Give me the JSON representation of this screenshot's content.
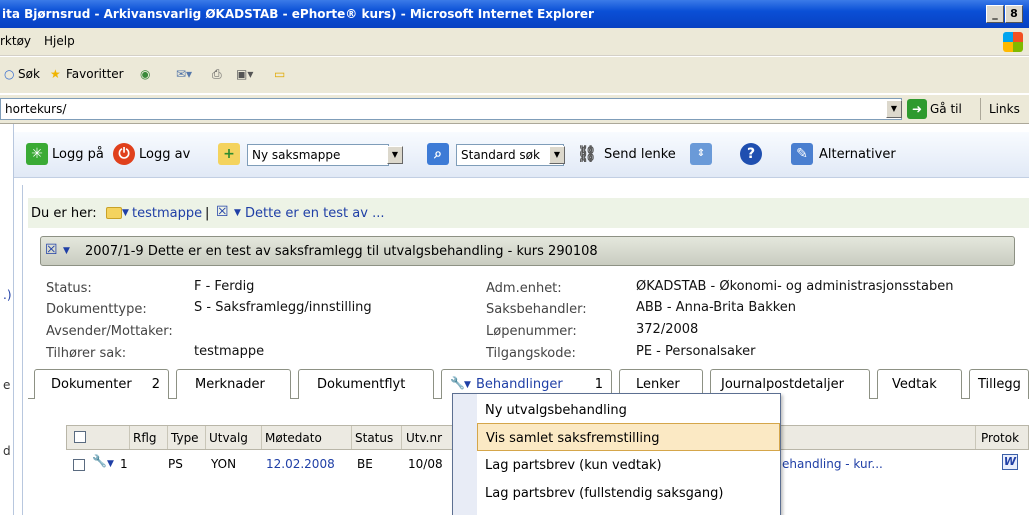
{
  "window": {
    "title": "ita Bjørnsrud - Arkivansvarlig ØKADSTAB - ePhorte® kurs) - Microsoft Internet Explorer",
    "min_btn": "_",
    "max_btn": "8"
  },
  "menubar": {
    "items": [
      "rktøy",
      "Hjelp"
    ]
  },
  "ie_toolbar": {
    "search": "Søk",
    "favorites": "Favoritter"
  },
  "address": {
    "value": "hortekurs/",
    "go": "Gå til",
    "links": "Links"
  },
  "ephorte_toolbar": {
    "login": "Logg på",
    "logout": "Logg av",
    "new_folder_select": "Ny saksmappe",
    "search_select": "Standard søk",
    "send_link": "Send lenke",
    "alternatives": "Alternativer"
  },
  "gutter": {
    "t1": ".)",
    "t2": "e",
    "t3": "d"
  },
  "breadcrumb": {
    "prefix": "Du er her:",
    "item1": "testmappe",
    "sep": "|",
    "item2": "Dette er en test av ..."
  },
  "document": {
    "header": "2007/1-9  Dette er en test av saksframlegg til utvalgsbehandling - kurs 290108",
    "left_fields": [
      {
        "label": "Status:",
        "value": "F - Ferdig"
      },
      {
        "label": "Dokumenttype:",
        "value": "S - Saksframlegg/innstilling"
      },
      {
        "label": "Avsender/Mottaker:",
        "value": ""
      },
      {
        "label": "Tilhører sak:",
        "value": "testmappe"
      }
    ],
    "right_fields": [
      {
        "label": "Adm.enhet:",
        "value": "ØKADSTAB - Økonomi- og administrasjonsstaben"
      },
      {
        "label": "Saksbehandler:",
        "value": "ABB - Anna-Brita Bakken"
      },
      {
        "label": "Løpenummer:",
        "value": "372/2008"
      },
      {
        "label": "Tilgangskode:",
        "value": "PE - Personalsaker"
      }
    ]
  },
  "tabs": [
    {
      "label": "Dokumenter",
      "count": "2"
    },
    {
      "label": "Merknader",
      "count": ""
    },
    {
      "label": "Dokumentflyt",
      "count": ""
    },
    {
      "label": "Behandlinger",
      "count": "1"
    },
    {
      "label": "Lenker",
      "count": ""
    },
    {
      "label": "Journalpostdetaljer",
      "count": ""
    },
    {
      "label": "Vedtak",
      "count": ""
    },
    {
      "label": "Tillegg",
      "count": ""
    }
  ],
  "table": {
    "headers": [
      "Rflg",
      "Type",
      "Utvalg",
      "Møtedato",
      "Status",
      "Utv.nr",
      "Protok"
    ],
    "row": {
      "rflg": "1",
      "type": "PS",
      "utvalg": "YON",
      "date": "12.02.2008",
      "status": "BE",
      "utvnr": "10/08",
      "title": "ehandling - kur..."
    }
  },
  "dropdown": {
    "items": [
      "Ny utvalgsbehandling",
      "Vis samlet saksfremstilling",
      "Lag partsbrev (kun vedtak)",
      "Lag partsbrev (fullstendig saksgang)"
    ],
    "highlighted": 1
  },
  "colors": {
    "accent": "#1f3fa6",
    "highlight": "#fbe9c4"
  }
}
